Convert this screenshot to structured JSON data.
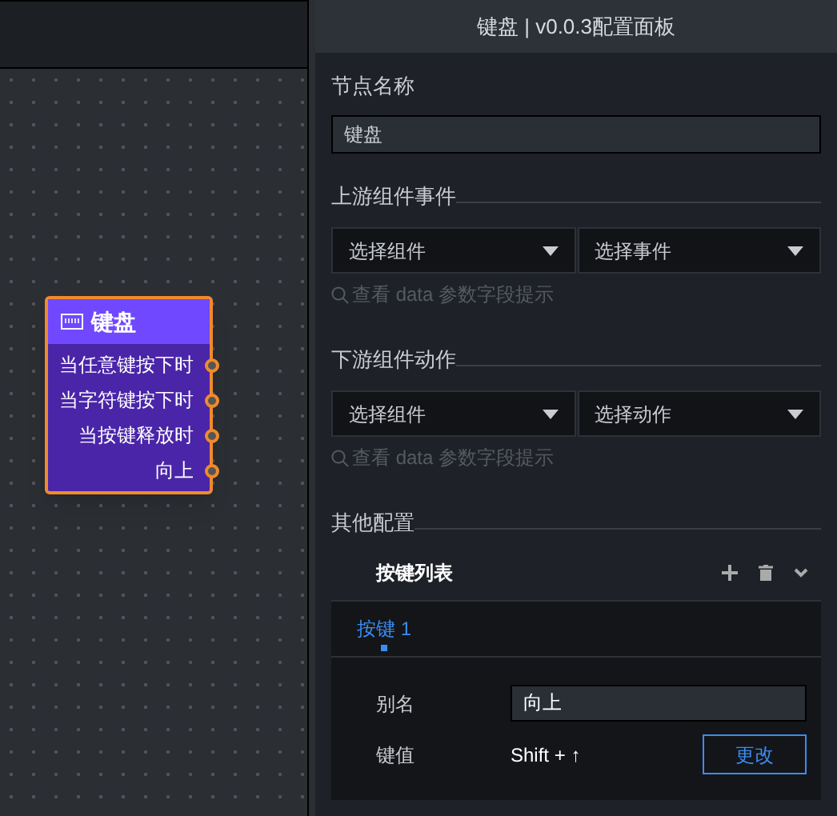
{
  "node": {
    "title": "键盘",
    "outputs": [
      "当任意键按下时",
      "当字符键按下时",
      "当按键释放时",
      "向上"
    ]
  },
  "panel": {
    "title": "键盘 | v0.0.3配置面板",
    "node_name": {
      "label": "节点名称",
      "value": "键盘"
    },
    "upstream": {
      "title": "上游组件事件",
      "selects": [
        "选择组件",
        "选择事件"
      ],
      "hint": "查看 data 参数字段提示"
    },
    "downstream": {
      "title": "下游组件动作",
      "selects": [
        "选择组件",
        "选择动作"
      ],
      "hint": "查看 data 参数字段提示"
    },
    "other": {
      "title": "其他配置",
      "list_title": "按键列表",
      "tabs": [
        {
          "label": "按键 1",
          "selected": true
        }
      ],
      "alias": {
        "label": "别名",
        "value": "向上"
      },
      "key": {
        "label": "键值",
        "value": "Shift + ↑",
        "button": "更改"
      }
    }
  }
}
